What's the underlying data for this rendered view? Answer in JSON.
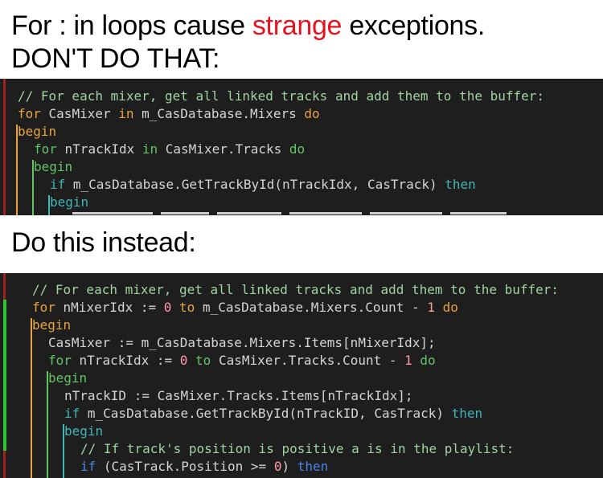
{
  "headings": {
    "bad_prefix": "For : in loops cause ",
    "bad_accent": "strange",
    "bad_suffix": " exceptions.",
    "bad_line2": "DON'T DO THAT:",
    "good": "Do this instead:"
  },
  "colors": {
    "editor_bg": "#1e1e1e",
    "comment": "#9fd3a0",
    "keyword_orange": "#e8a33c",
    "keyword_green": "#62c462",
    "keyword_teal": "#3fb6b6",
    "keyword_blue": "#4a86e8",
    "text": "#d4d4d4",
    "number": "#ff9aa2",
    "accent_red": "#e8121e",
    "gutter_red": "#a12020",
    "gutter_green": "#2fc52f"
  },
  "bad_code": [
    {
      "indent": 0,
      "tokens": [
        {
          "t": "// For each mixer, get all linked tracks and add them to the buffer:",
          "c": "comment"
        }
      ]
    },
    {
      "indent": 0,
      "tokens": [
        {
          "t": "for",
          "c": "keyword_orange"
        },
        {
          "t": " CasMixer ",
          "c": "text"
        },
        {
          "t": "in",
          "c": "keyword_orange"
        },
        {
          "t": " m_CasDatabase.Mixers ",
          "c": "text"
        },
        {
          "t": "do",
          "c": "keyword_orange"
        }
      ]
    },
    {
      "indent": 0,
      "tokens": [
        {
          "t": "begin",
          "c": "keyword_orange"
        }
      ]
    },
    {
      "indent": 1,
      "tokens": [
        {
          "t": "for",
          "c": "keyword_green"
        },
        {
          "t": " nTrackIdx ",
          "c": "text"
        },
        {
          "t": "in",
          "c": "keyword_green"
        },
        {
          "t": " CasMixer.Tracks ",
          "c": "text"
        },
        {
          "t": "do",
          "c": "keyword_green"
        }
      ]
    },
    {
      "indent": 1,
      "tokens": [
        {
          "t": "begin",
          "c": "keyword_green"
        }
      ]
    },
    {
      "indent": 2,
      "tokens": [
        {
          "t": "if",
          "c": "keyword_teal"
        },
        {
          "t": " m_CasDatabase.GetTrackById(nTrackIdx, CasTrack) ",
          "c": "text"
        },
        {
          "t": "then",
          "c": "keyword_teal"
        }
      ]
    },
    {
      "indent": 2,
      "tokens": [
        {
          "t": "begin",
          "c": "keyword_teal"
        }
      ]
    }
  ],
  "good_code": [
    {
      "indent": 0,
      "tokens": [
        {
          "t": "// For each mixer, get all linked tracks and add them to the buffer:",
          "c": "comment"
        }
      ]
    },
    {
      "indent": 0,
      "tokens": [
        {
          "t": "for",
          "c": "keyword_orange"
        },
        {
          "t": " nMixerIdx := ",
          "c": "text"
        },
        {
          "t": "0",
          "c": "number"
        },
        {
          "t": " ",
          "c": "text"
        },
        {
          "t": "to",
          "c": "keyword_orange"
        },
        {
          "t": " m_CasDatabase.Mixers.Count - ",
          "c": "text"
        },
        {
          "t": "1",
          "c": "number"
        },
        {
          "t": " ",
          "c": "text"
        },
        {
          "t": "do",
          "c": "keyword_orange"
        }
      ]
    },
    {
      "indent": 0,
      "tokens": [
        {
          "t": "begin",
          "c": "keyword_orange"
        }
      ]
    },
    {
      "indent": 1,
      "tokens": [
        {
          "t": "CasMixer := m_CasDatabase.Mixers.Items[nMixerIdx];",
          "c": "text"
        }
      ]
    },
    {
      "indent": 1,
      "tokens": [
        {
          "t": "for",
          "c": "keyword_green"
        },
        {
          "t": " nTrackIdx := ",
          "c": "text"
        },
        {
          "t": "0",
          "c": "number"
        },
        {
          "t": " ",
          "c": "text"
        },
        {
          "t": "to",
          "c": "keyword_green"
        },
        {
          "t": " CasMixer.Tracks.Count - ",
          "c": "text"
        },
        {
          "t": "1",
          "c": "number"
        },
        {
          "t": " ",
          "c": "text"
        },
        {
          "t": "do",
          "c": "keyword_green"
        }
      ]
    },
    {
      "indent": 1,
      "tokens": [
        {
          "t": "begin",
          "c": "keyword_green"
        }
      ]
    },
    {
      "indent": 2,
      "tokens": [
        {
          "t": "nTrackID := CasMixer.Tracks.Items[nTrackIdx];",
          "c": "text"
        }
      ]
    },
    {
      "indent": 2,
      "tokens": [
        {
          "t": "if",
          "c": "keyword_teal"
        },
        {
          "t": " m_CasDatabase.GetTrackById(nTrackID, CasTrack) ",
          "c": "text"
        },
        {
          "t": "then",
          "c": "keyword_teal"
        }
      ]
    },
    {
      "indent": 2,
      "tokens": [
        {
          "t": "begin",
          "c": "keyword_teal"
        }
      ]
    },
    {
      "indent": 3,
      "tokens": [
        {
          "t": "// If track's position is positive a is in the playlist:",
          "c": "comment"
        }
      ]
    },
    {
      "indent": 3,
      "tokens": [
        {
          "t": "if",
          "c": "keyword_blue"
        },
        {
          "t": " (CasTrack.Position >= ",
          "c": "text"
        },
        {
          "t": "0",
          "c": "number"
        },
        {
          "t": ") ",
          "c": "text"
        },
        {
          "t": "then",
          "c": "keyword_blue"
        }
      ]
    }
  ]
}
